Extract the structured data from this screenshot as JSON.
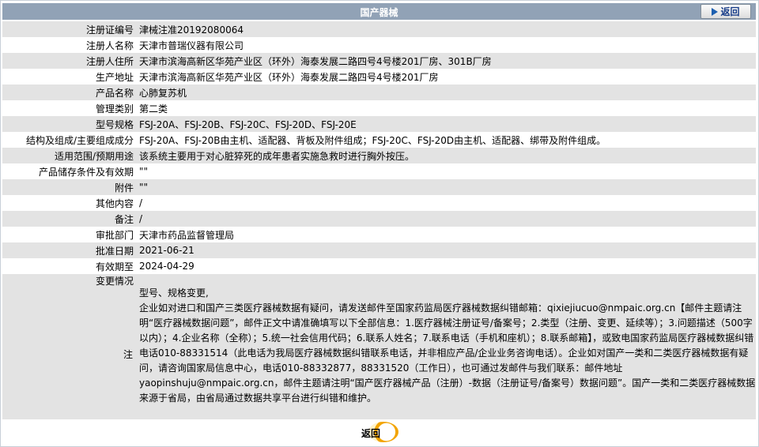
{
  "header": {
    "title": "国产器械",
    "back_label": "返回"
  },
  "rows": [
    {
      "label": "注册证编号",
      "value": "津械注准20192080064"
    },
    {
      "label": "注册人名称",
      "value": "天津市普瑞仪器有限公司"
    },
    {
      "label": "注册人住所",
      "value": "天津市滨海高新区华苑产业区（环外）海泰发展二路四号4号楼201厂房、301B厂房"
    },
    {
      "label": "生产地址",
      "value": "天津市滨海高新区华苑产业区（环外）海泰发展二路四号4号楼201厂房"
    },
    {
      "label": "产品名称",
      "value": "心肺复苏机"
    },
    {
      "label": "管理类别",
      "value": "第二类"
    },
    {
      "label": "型号规格",
      "value": "FSJ-20A、FSJ-20B、FSJ-20C、FSJ-20D、FSJ-20E"
    },
    {
      "label": "结构及组成/主要组成成分",
      "value": "FSJ-20A、FSJ-20B由主机、适配器、背板及附件组成；FSJ-20C、FSJ-20D由主机、适配器、绑带及附件组成。"
    },
    {
      "label": "适用范围/预期用途",
      "value": "该系统主要用于对心脏猝死的成年患者实施急救时进行胸外按压。"
    },
    {
      "label": "产品储存条件及有效期",
      "value": "\"\""
    },
    {
      "label": "附件",
      "value": "\"\""
    },
    {
      "label": "其他内容",
      "value": "/"
    },
    {
      "label": "备注",
      "value": "/"
    },
    {
      "label": "审批部门",
      "value": "天津市药品监督管理局"
    },
    {
      "label": "批准日期",
      "value": "2021-06-21"
    },
    {
      "label": "有效期至",
      "value": "2024-04-29"
    }
  ],
  "change": {
    "label": "变更情况",
    "value": "型号、规格变更,"
  },
  "note": {
    "label": "注",
    "text": "企业如对进口和国产三类医疗器械数据有疑问，请发送邮件至国家药监局医疗器械数据纠错邮箱：qixiejiucuo@nmpaic.org.cn【邮件主题请注明“医疗器械数据问题”，邮件正文中请准确填写以下全部信息：1.医疗器械注册证号/备案号；2.类型（注册、变更、延续等）；3.问题描述（500字以内）；4.企业名称（全称）；5.统一社会信用代码；6.联系人姓名；7.联系电话（手机和座机）；8.联系邮箱】，或致电国家药监局医疗器械数据纠错电话010-88331514（此电话为我局医疗器械数据纠错联系电话，并非相应产品/企业业务咨询电话）。企业如对国产一类和二类医疗器械数据有疑问，请咨询国家局信息中心，电话010-88332877，88331520（工作日），也可通过发邮件与我们联系：邮件地址yaopinshuju@nmpaic.org.cn，邮件主题请注明“国产医疗器械产品（注册）-数据（注册证号/备案号）数据问题”。国产一类和二类医疗器械数据来源于省局，由省局通过数据共享平台进行纠错和维护。"
  },
  "footer": {
    "back_label": "返回"
  }
}
